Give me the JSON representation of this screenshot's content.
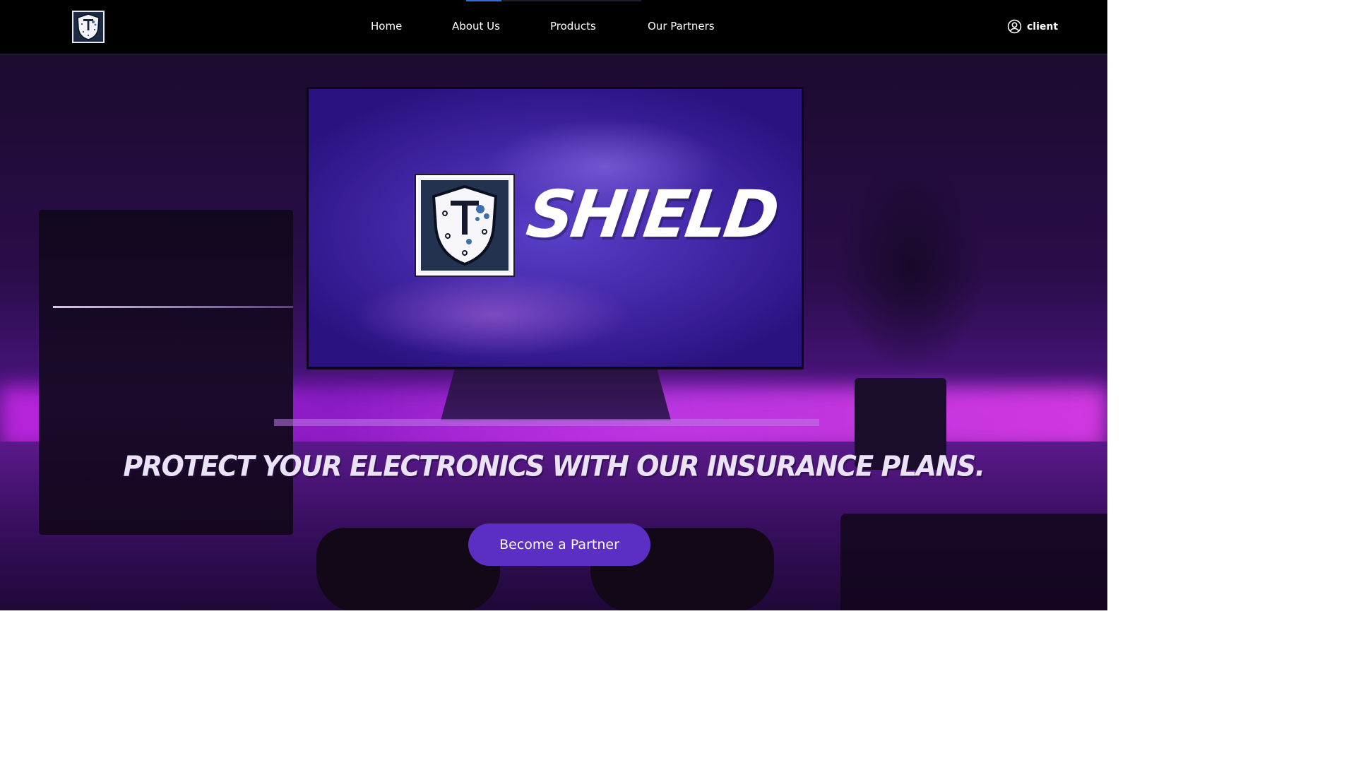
{
  "brand": {
    "logo_icon": "shield-icon",
    "screen_title": "SHIELD"
  },
  "nav": {
    "items": [
      {
        "label": "Home"
      },
      {
        "label": "About Us"
      },
      {
        "label": "Products"
      },
      {
        "label": "Our Partners"
      }
    ],
    "active_index": 0
  },
  "account": {
    "icon": "user-circle-icon",
    "label": "client"
  },
  "hero": {
    "tagline": "Protect your electronics with our insurance plans.",
    "cta_label": "Become a Partner"
  },
  "colors": {
    "header_bg": "#000000",
    "accent": "#5b2fc4",
    "active_indicator": "#2f6fd6",
    "hero_glow": "#e437f0"
  }
}
